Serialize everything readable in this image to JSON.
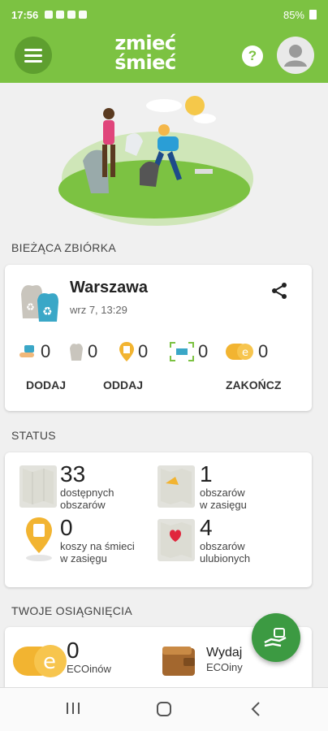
{
  "statusbar": {
    "time": "17:56",
    "battery": "85%"
  },
  "appbar": {
    "logo_line1": "zmieć",
    "logo_line2": "śmieć",
    "help_label": "?"
  },
  "current": {
    "section_title": "BIEŻĄCA ZBIÓRKA",
    "city": "Warszawa",
    "date": "wrz 7, 13:29",
    "stats": [
      "0",
      "0",
      "0",
      "0",
      "0"
    ],
    "actions": {
      "add": "DODAJ",
      "give": "ODDAJ",
      "finish": "ZAKOŃCZ"
    }
  },
  "status": {
    "section_title": "STATUS",
    "items": [
      {
        "num": "33",
        "label1": "dostępnych",
        "label2": "obszarów"
      },
      {
        "num": "1",
        "label1": "obszarów",
        "label2": "w zasięgu"
      },
      {
        "num": "0",
        "label1": "koszy na śmieci",
        "label2": "w zasięgu"
      },
      {
        "num": "4",
        "label1": "obszarów",
        "label2": "ulubionych"
      }
    ]
  },
  "achievements": {
    "section_title": "TWOJE OSIĄGNIĘCIA",
    "eco_num": "0",
    "eco_label": "ECOinów",
    "spend_title": "Wydaj",
    "spend_label": "ECOiny"
  },
  "colors": {
    "brand_green": "#7cc242",
    "fab_green": "#3c9a42"
  }
}
